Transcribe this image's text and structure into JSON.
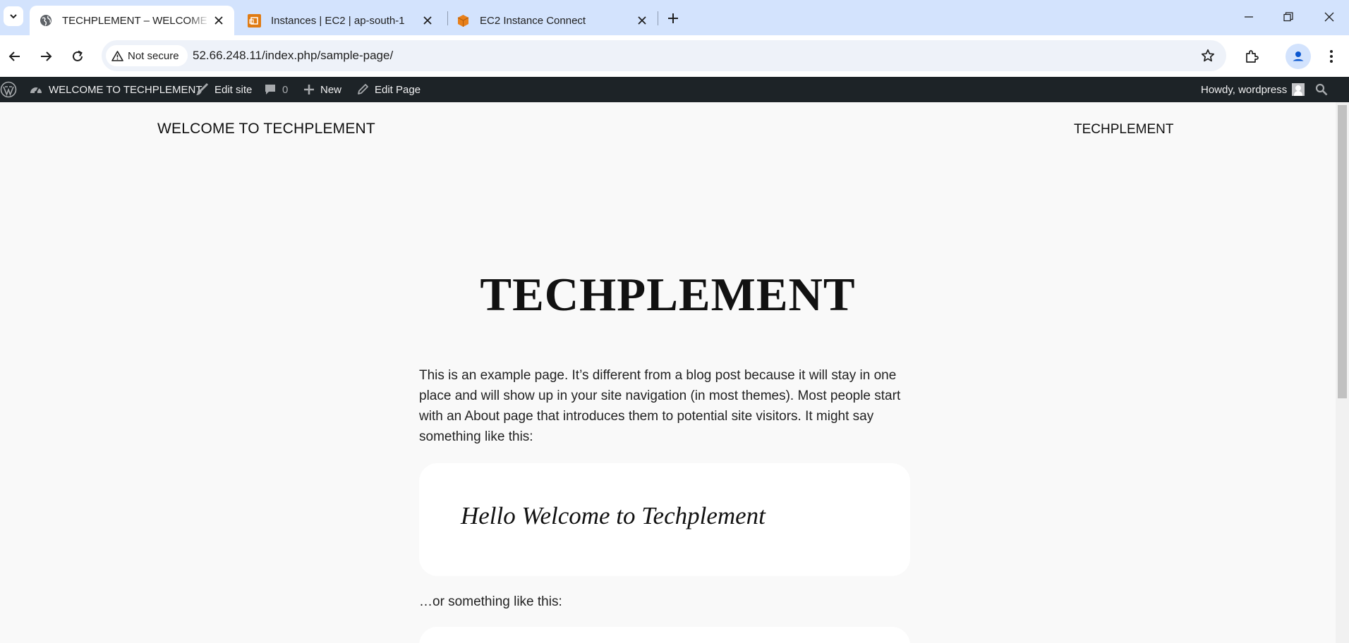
{
  "browser": {
    "tabs": [
      {
        "title": "TECHPLEMENT – WELCOME TO",
        "icon": "globe-icon",
        "active": true
      },
      {
        "title": "Instances | EC2 | ap-south-1",
        "icon": "aws-ec2-icon",
        "active": false
      },
      {
        "title": "EC2 Instance Connect",
        "icon": "aws-cube-icon",
        "active": false
      }
    ],
    "security_chip": "Not secure",
    "url": "52.66.248.11/index.php/sample-page/"
  },
  "admin_bar": {
    "site_name": "WELCOME TO TECHPLEMENT",
    "edit_site": "Edit site",
    "comments_count": "0",
    "new_label": "New",
    "edit_page": "Edit Page",
    "howdy": "Howdy, wordpress"
  },
  "site": {
    "title": "WELCOME TO TECHPLEMENT",
    "nav_link": "TECHPLEMENT"
  },
  "content": {
    "heading": "TECHPLEMENT",
    "intro": "This is an example page. It’s different from a blog post because it will stay in one place and will show up in your site navigation (in most themes). Most people start with an About page that introduces them to potential site visitors. It might say something like this:",
    "quote": "Hello Welcome to Techplement",
    "or_text": "…or something like this:"
  },
  "colors": {
    "tabstrip": "#d3e3fd",
    "admin_bar": "#1d2327",
    "page_bg": "#f9f9f9"
  }
}
